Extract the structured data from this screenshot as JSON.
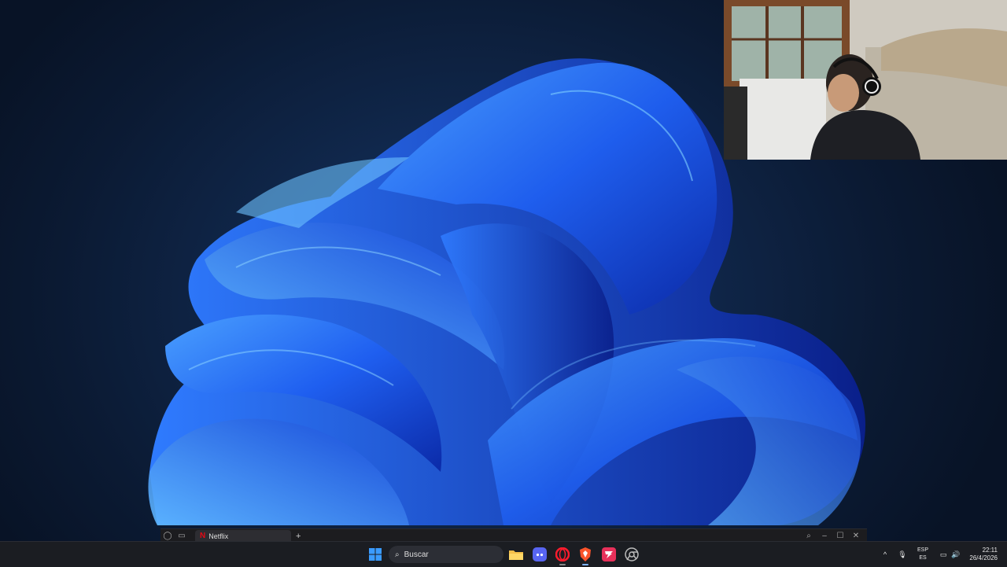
{
  "browser": {
    "tab_title": "Netflix",
    "tab_favicon": "N",
    "new_tab_label": "+"
  },
  "taskbar": {
    "search_placeholder": "Buscar",
    "apps": [
      {
        "name": "file-explorer-icon"
      },
      {
        "name": "discord-icon"
      },
      {
        "name": "opera-icon"
      },
      {
        "name": "brave-icon"
      },
      {
        "name": "app-red-icon"
      },
      {
        "name": "chrome-icon"
      }
    ]
  },
  "tray": {
    "overflow": "^",
    "language_top": "ESP",
    "language_bottom": "ES",
    "time": "22:11",
    "date": "26/4/2026"
  },
  "colors": {
    "accent": "#3a6bff",
    "netflix": "#e50914",
    "taskbar_bg": "#1b1d22"
  }
}
